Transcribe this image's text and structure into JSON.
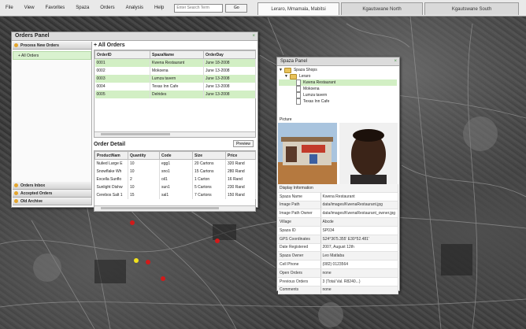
{
  "menu": {
    "items": [
      "File",
      "View",
      "Favorites",
      "Spaza",
      "Orders",
      "Analysis",
      "Help"
    ],
    "search_placeholder": "Enter Search Term",
    "go_label": "Go"
  },
  "location_tabs": [
    "Leraro, Mmamala, Mabitsi",
    "Kgautswane North",
    "Kgautswane South"
  ],
  "orders_panel": {
    "title": "Orders Panel",
    "sidebar": {
      "process_new": "Process New Orders",
      "all_orders": "+ All Orders",
      "inbox": "Orders Inbox",
      "accepted": "Accepted Orders",
      "archive": "Old Archive"
    },
    "all_orders_heading": "+ All Orders",
    "columns": [
      "OrderID",
      "SpazaName",
      "OrderDay"
    ],
    "rows": [
      {
        "id": "0001",
        "name": "Kwena Restaurant",
        "day": "June 18-2008"
      },
      {
        "id": "0002",
        "name": "Mokoena",
        "day": "June 13-2008"
      },
      {
        "id": "0003",
        "name": "Lumza tavern",
        "day": "June 13-2008"
      },
      {
        "id": "0004",
        "name": "Texas Inn Cafe",
        "day": "June 13-2008"
      },
      {
        "id": "0005",
        "name": "Delrides",
        "day": "June 13-2008"
      }
    ],
    "detail_heading": "Order Detail",
    "preview_label": "Preview",
    "detail_columns": [
      "ProductNam",
      "Quantity",
      "Code",
      "Size",
      "Price"
    ],
    "detail_rows": [
      [
        "Nulied Large E",
        "10",
        "egg1",
        "20 Cartons",
        "320 Rand"
      ],
      [
        "Snowflake Wh",
        "10",
        "sno1",
        "15 Cartons",
        "280 Rand"
      ],
      [
        "Excella Sunflo",
        "2",
        "oil1",
        "1 Carton",
        "16 Rand"
      ],
      [
        "Sunlight Dishw",
        "10",
        "sun1",
        "5 Cartons",
        "230 Rand"
      ],
      [
        "Cerebos Salt 1",
        "15",
        "sal1",
        "7 Cartons",
        "150 Rand"
      ]
    ]
  },
  "spaza_panel": {
    "title": "Spaza Panel",
    "tree": {
      "root": "Spaza Shops",
      "group": "Leraro",
      "shops": [
        "Kwena Restaurant",
        "Mokoena",
        "Lumza tavern",
        "Texas Inn Cafe"
      ]
    },
    "picture_label": "Picture",
    "display_heading": "Display Information",
    "fields": [
      {
        "k": "Spaza Name",
        "v": "Kwena Restaurant"
      },
      {
        "k": "Image Path",
        "v": "data/images/KwenaRestaurant.jpg"
      },
      {
        "k": "Image Path Owner",
        "v": "data/images/KwenaRestaurant_owner.jpg"
      },
      {
        "k": "Village",
        "v": "Abcde"
      },
      {
        "k": "Spaza ID",
        "v": "SP034"
      },
      {
        "k": "GPS Coordinates",
        "v": "S24°36'5.355' E30°52.481'"
      },
      {
        "k": "Date Registered",
        "v": "2007, August 12th"
      },
      {
        "k": "Spaza Owner",
        "v": "Leo Matlaba"
      },
      {
        "k": "Cell Phone",
        "v": "(082) 0123564"
      },
      {
        "k": "Open Orders",
        "v": "none"
      },
      {
        "k": "Previous Orders",
        "v": "3 (Total Val. R8240...)"
      },
      {
        "k": "Comments",
        "v": "none"
      }
    ]
  },
  "colors": {
    "selected_row": "#d2efc4",
    "marker_red": "#d11a1a",
    "marker_yellow": "#f2e21c"
  }
}
